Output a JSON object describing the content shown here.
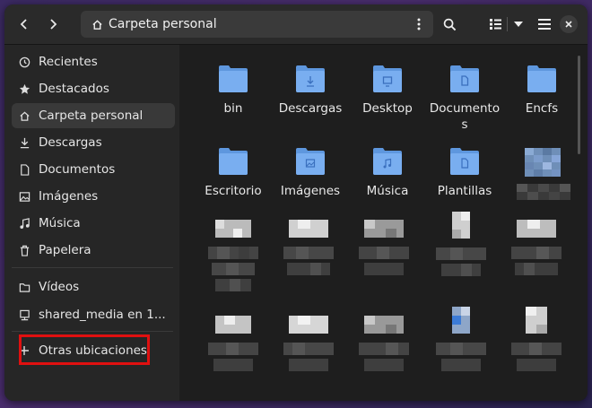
{
  "header": {
    "path_label": "Carpeta personal"
  },
  "sidebar": {
    "items": [
      {
        "label": "Recientes",
        "icon": "clock-icon"
      },
      {
        "label": "Destacados",
        "icon": "star-icon"
      },
      {
        "label": "Carpeta personal",
        "icon": "home-icon",
        "active": true
      },
      {
        "label": "Descargas",
        "icon": "download-icon"
      },
      {
        "label": "Documentos",
        "icon": "document-icon"
      },
      {
        "label": "Imágenes",
        "icon": "image-icon"
      },
      {
        "label": "Música",
        "icon": "music-icon"
      },
      {
        "label": "Papelera",
        "icon": "trash-icon"
      },
      {
        "label": "Vídeos",
        "icon": "video-icon"
      },
      {
        "label": "shared_media en 1...",
        "icon": "network-drive-icon"
      },
      {
        "label": "Otras ubicaciones",
        "icon": "plus-icon"
      }
    ]
  },
  "files": [
    {
      "name": "bin",
      "icon": "folder-icon"
    },
    {
      "name": "Descargas",
      "icon": "folder-download-icon"
    },
    {
      "name": "Desktop",
      "icon": "folder-desktop-icon"
    },
    {
      "name": "Documentos",
      "icon": "folder-documents-icon"
    },
    {
      "name": "Encfs",
      "icon": "folder-icon"
    },
    {
      "name": "Escritorio",
      "icon": "folder-icon"
    },
    {
      "name": "Imágenes",
      "icon": "folder-pictures-icon"
    },
    {
      "name": "Música",
      "icon": "folder-music-icon"
    },
    {
      "name": "Plantillas",
      "icon": "folder-templates-icon"
    }
  ],
  "colors": {
    "folder": "#79aef0",
    "folder_tab": "#5e97de",
    "highlight_border": "#e01010"
  }
}
